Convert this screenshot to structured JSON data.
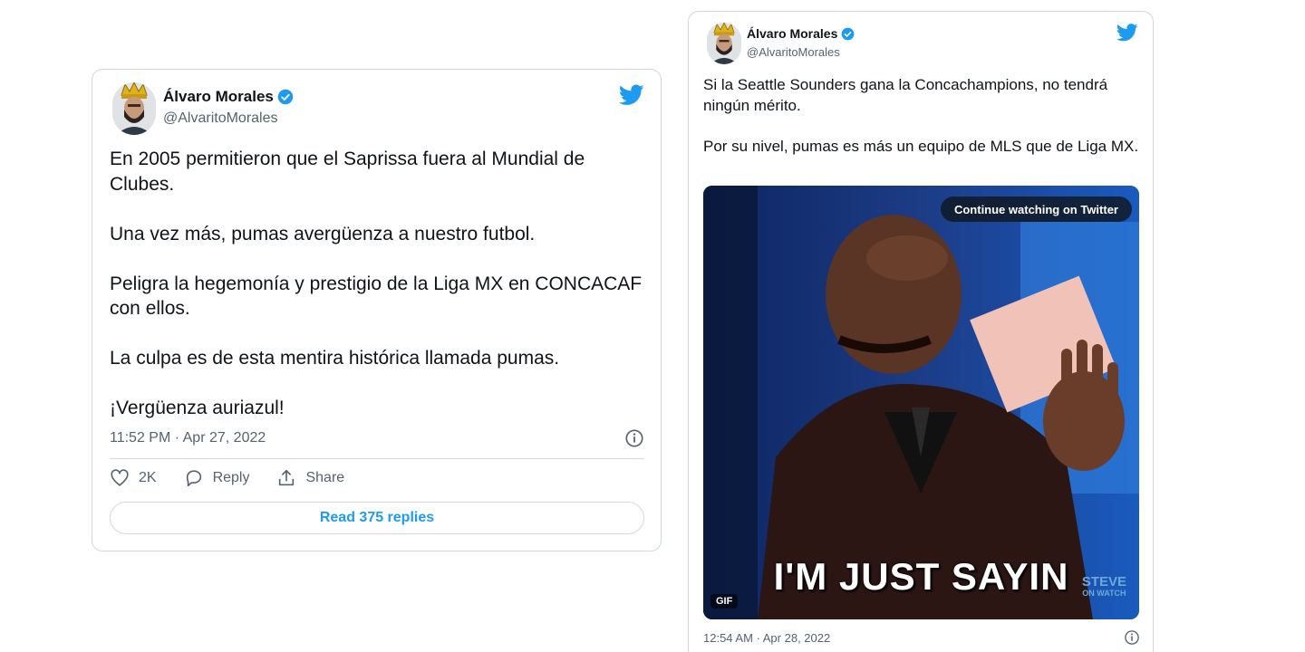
{
  "colors": {
    "accent": "#1d9bf0",
    "muted": "#536471",
    "border": "#cfd9de",
    "text": "#0f1419"
  },
  "tweet1": {
    "author_name": "Álvaro Morales",
    "author_handle": "@AlvaritoMorales",
    "text": "En 2005 permitieron que el Saprissa fuera al Mundial de Clubes.\n\nUna vez más, pumas avergüenza a nuestro futbol.\n\nPeligra la hegemonía y prestigio de la Liga MX en CONCACAF con ellos.\n\nLa culpa es de esta mentira histórica llamada pumas.\n\n¡Vergüenza auriazul!",
    "timestamp": "11:52 PM · Apr 27, 2022",
    "likes": "2K",
    "reply_label": "Reply",
    "share_label": "Share",
    "read_replies": "Read 375 replies",
    "icons": [
      "verified-badge-icon",
      "twitter-bird-icon",
      "info-icon",
      "heart-icon",
      "reply-icon",
      "share-icon"
    ]
  },
  "tweet2": {
    "author_name": "Álvaro Morales",
    "author_handle": "@AlvaritoMorales",
    "text": "Si la Seattle Sounders gana la Concachampions, no tendrá ningún mérito.\n\nPor su nivel, pumas es más un equipo de MLS que de Liga MX.",
    "media": {
      "continue_label": "Continue watching on Twitter",
      "caption": "I'M JUST SAYIN",
      "badge": "GIF",
      "watermark_line1": "STEVE",
      "watermark_line2": "ON WATCH"
    },
    "timestamp": "12:54 AM · Apr 28, 2022",
    "icons": [
      "verified-badge-icon",
      "twitter-bird-icon",
      "info-icon"
    ]
  }
}
